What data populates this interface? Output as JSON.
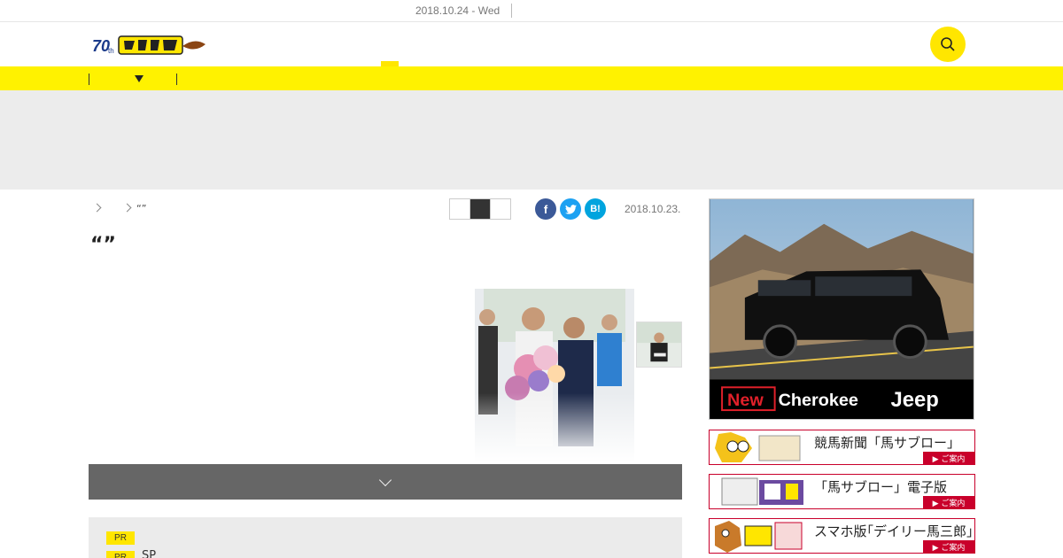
{
  "topbar": {
    "date": "2018.10.24 - Wed"
  },
  "colors": {
    "brand_yellow": "#fff200",
    "accent_red": "#c9002b",
    "bar_gray": "#666666"
  },
  "breadcrumb": {
    "current": "“”"
  },
  "article": {
    "date": "2018.10.23.",
    "title": "“”"
  },
  "share": {
    "facebook": "f",
    "twitter": "t",
    "hatena": "B!"
  },
  "pr": {
    "tag1": "PR",
    "tag2": "PR",
    "text2": "SP"
  },
  "side_ad": {
    "new_label": "New",
    "model": "Cherokee",
    "brand": "Jeep"
  },
  "banners": [
    {
      "title": "競馬新聞「馬サブロー」",
      "button": "▶ ご案内"
    },
    {
      "title": "「馬サブロー」電子版",
      "button": "▶ ご案内"
    },
    {
      "title": "スマホ版｢デイリー馬三郎｣",
      "button": "▶ ご案内"
    }
  ],
  "icons": {
    "search": "search-icon",
    "chevron": "chevron-down-icon"
  }
}
